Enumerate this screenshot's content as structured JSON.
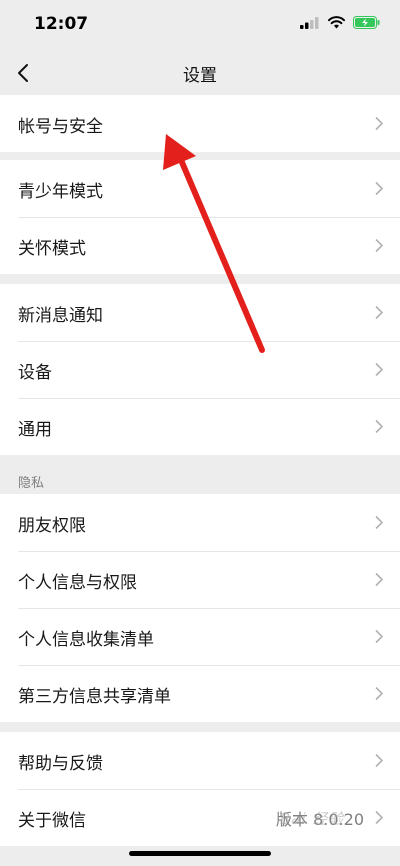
{
  "status_bar": {
    "time": "12:07"
  },
  "header": {
    "title": "设置"
  },
  "groups": [
    {
      "items": [
        {
          "label": "帐号与安全"
        }
      ]
    },
    {
      "items": [
        {
          "label": "青少年模式"
        },
        {
          "label": "关怀模式"
        }
      ]
    },
    {
      "items": [
        {
          "label": "新消息通知"
        },
        {
          "label": "设备"
        },
        {
          "label": "通用"
        }
      ]
    },
    {
      "section_title": "隐私",
      "items": [
        {
          "label": "朋友权限"
        },
        {
          "label": "个人信息与权限"
        },
        {
          "label": "个人信息收集清单"
        },
        {
          "label": "第三方信息共享清单"
        }
      ]
    },
    {
      "items": [
        {
          "label": "帮助与反馈"
        },
        {
          "label": "关于微信",
          "value": "版本 8.0.20"
        }
      ]
    }
  ],
  "watermark": "Bai 经验",
  "colors": {
    "background": "#ededed",
    "annotation_arrow": "#e3201b",
    "battery": "#34c759"
  }
}
